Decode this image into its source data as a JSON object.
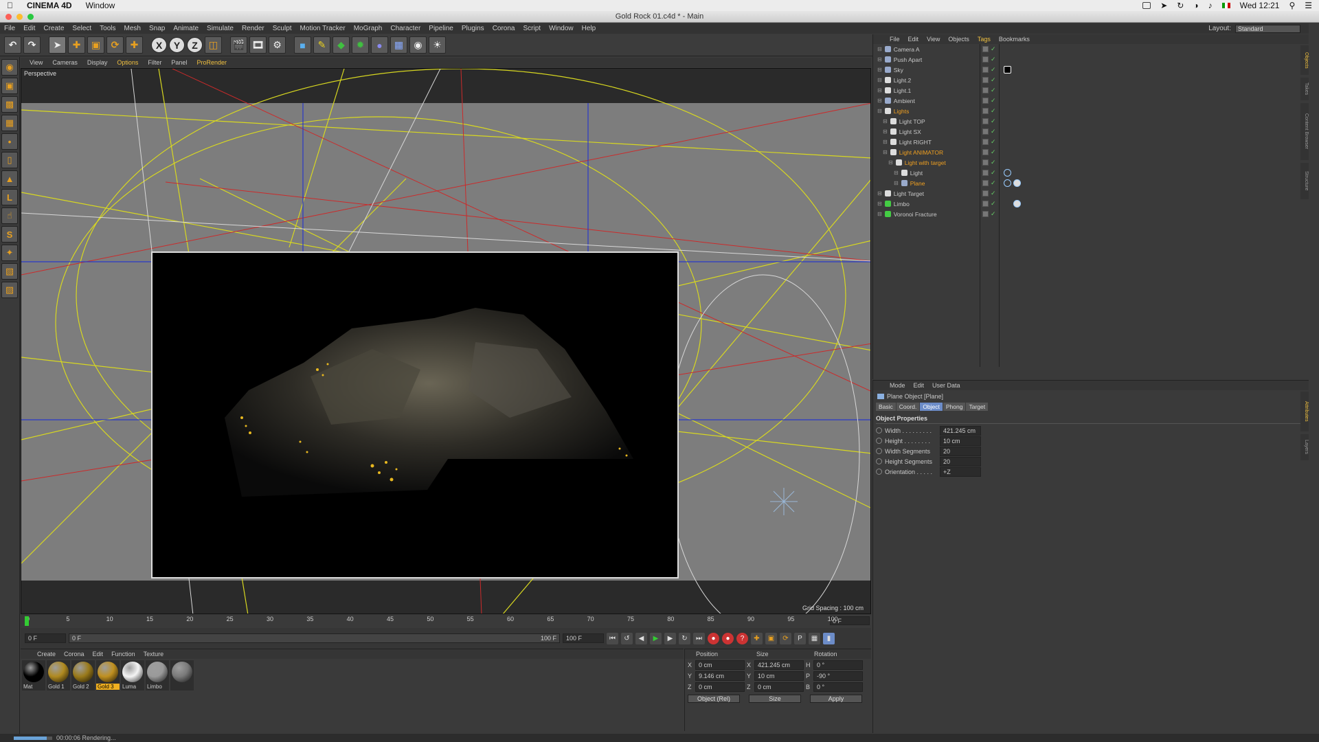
{
  "mac": {
    "app": "CINEMA 4D",
    "menu": "Window",
    "time": "Wed 12:21"
  },
  "window_title": "Gold Rock 01.c4d * - Main",
  "app_menu": [
    "File",
    "Edit",
    "Create",
    "Select",
    "Tools",
    "Mesh",
    "Snap",
    "Animate",
    "Simulate",
    "Render",
    "Sculpt",
    "Motion Tracker",
    "MoGraph",
    "Character",
    "Pipeline",
    "Plugins",
    "Corona",
    "Script",
    "Window",
    "Help"
  ],
  "layout": {
    "label": "Layout:",
    "value": "Standard"
  },
  "toolbar": {
    "axis_x": "X",
    "axis_y": "Y",
    "axis_z": "Z"
  },
  "viewport": {
    "menu": [
      "View",
      "Cameras",
      "Display",
      "Options",
      "Filter",
      "Panel",
      "ProRender"
    ],
    "label": "Perspective",
    "grid_spacing": "Grid Spacing : 100 cm"
  },
  "timeline": {
    "ticks": [
      "0",
      "5",
      "10",
      "15",
      "20",
      "25",
      "30",
      "35",
      "40",
      "45",
      "50",
      "55",
      "60",
      "65",
      "70",
      "75",
      "80",
      "85",
      "90",
      "95",
      "100"
    ],
    "current_frame": "0 F",
    "start_field": "0 F",
    "slider_start": "0 F",
    "slider_end": "100 F",
    "end_field": "100 F"
  },
  "materials": {
    "menu": [
      "Create",
      "Corona",
      "Edit",
      "Function",
      "Texture"
    ],
    "items": [
      {
        "label": "Mat",
        "color": "#000000"
      },
      {
        "label": "Gold 1",
        "color": "#b08a20"
      },
      {
        "label": "Gold 2",
        "color": "#9a7a1a"
      },
      {
        "label": "Gold 3",
        "color": "#c09020"
      },
      {
        "label": "Luma",
        "color": "#f4f4f4"
      },
      {
        "label": "Limbo",
        "color": "#9a9a9a"
      },
      {
        "label": "",
        "color": "#7a7a7a"
      }
    ]
  },
  "coords": {
    "headers": [
      "Position",
      "Size",
      "Rotation"
    ],
    "rows": [
      {
        "axis": "X",
        "pos": "0 cm",
        "size_axis": "X",
        "size": "421.245 cm",
        "rot_axis": "H",
        "rot": "0 °"
      },
      {
        "axis": "Y",
        "pos": "9.146 cm",
        "size_axis": "Y",
        "size": "10 cm",
        "rot_axis": "P",
        "rot": "-90 °"
      },
      {
        "axis": "Z",
        "pos": "0 cm",
        "size_axis": "Z",
        "size": "0 cm",
        "rot_axis": "B",
        "rot": "0 °"
      }
    ],
    "mode": "Object (Rel)",
    "size_mode": "Size",
    "apply": "Apply"
  },
  "status": {
    "text": "00:00:06 Rendering...",
    "progress": 0.85
  },
  "objects": {
    "menu": [
      "File",
      "Edit",
      "View",
      "Objects",
      "Tags",
      "Bookmarks"
    ],
    "items": [
      {
        "name": "Camera A",
        "indent": 0
      },
      {
        "name": "Push Apart",
        "indent": 0
      },
      {
        "name": "Sky",
        "indent": 0
      },
      {
        "name": "Light.2",
        "indent": 0
      },
      {
        "name": "Light.1",
        "indent": 0
      },
      {
        "name": "Ambient",
        "indent": 0
      },
      {
        "name": "Lights",
        "indent": 0,
        "hl": true
      },
      {
        "name": "Light TOP",
        "indent": 1
      },
      {
        "name": "Light SX",
        "indent": 1
      },
      {
        "name": "Light RIGHT",
        "indent": 1
      },
      {
        "name": "Light ANIMATOR",
        "indent": 1,
        "hl": true
      },
      {
        "name": "Light with target",
        "indent": 2,
        "hl": true
      },
      {
        "name": "Light",
        "indent": 3
      },
      {
        "name": "Plane",
        "indent": 3,
        "hl": true
      },
      {
        "name": "Light Target",
        "indent": 0
      },
      {
        "name": "Limbo",
        "indent": 0
      },
      {
        "name": "Voronoi Fracture",
        "indent": 0
      }
    ],
    "side_tabs": [
      "Objects",
      "Takes",
      "Content Browser",
      "Structure"
    ]
  },
  "attributes": {
    "menu": [
      "Mode",
      "Edit",
      "User Data"
    ],
    "title": "Plane Object [Plane]",
    "tabs": [
      "Basic",
      "Coord.",
      "Object",
      "Phong",
      "Target"
    ],
    "selected_tab": "Object",
    "section": "Object Properties",
    "props": [
      {
        "label": "Width . . . . . . . . .",
        "value": "421.245 cm"
      },
      {
        "label": "Height . . . . . . . .",
        "value": "10 cm"
      },
      {
        "label": "Width Segments",
        "value": "20"
      },
      {
        "label": "Height Segments",
        "value": "20"
      },
      {
        "label": "Orientation . . . . .",
        "value": "+Z"
      }
    ],
    "side_tabs": [
      "Attributes",
      "Layers"
    ]
  },
  "colors": {
    "accent": "#f0c040",
    "selection": "#6c8cc8",
    "render_bg": "#000000"
  }
}
